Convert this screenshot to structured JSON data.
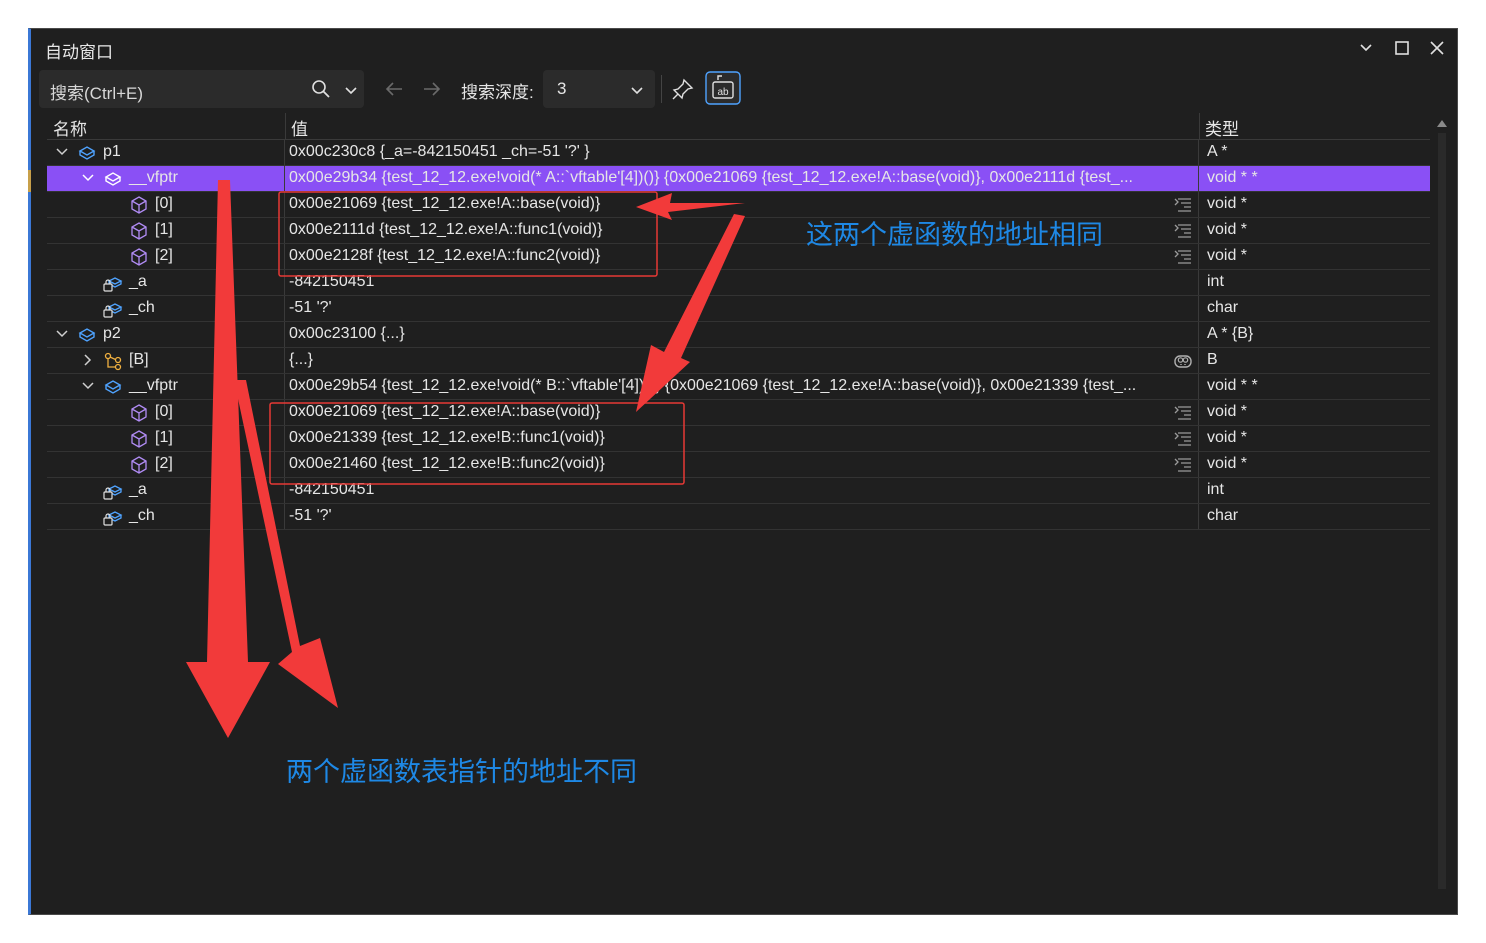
{
  "window": {
    "title": "自动窗口"
  },
  "toolbar": {
    "search_placeholder": "搜索(Ctrl+E)",
    "depth_label": "搜索深度:",
    "depth_value": "3"
  },
  "columns": {
    "name": "名称",
    "value": "值",
    "type": "类型"
  },
  "rows": [
    {
      "name": "p1",
      "value": "0x00c230c8 {_a=-842150451 _ch=-51 '?' }",
      "type": "A *"
    },
    {
      "name": "__vfptr",
      "value": "0x00e29b34 {test_12_12.exe!void(* A::`vftable'[4])()} {0x00e21069 {test_12_12.exe!A::base(void)}, 0x00e2111d {test_...",
      "type": "void * *"
    },
    {
      "name": "[0]",
      "value": "0x00e21069 {test_12_12.exe!A::base(void)}",
      "type": "void *"
    },
    {
      "name": "[1]",
      "value": "0x00e2111d {test_12_12.exe!A::func1(void)}",
      "type": "void *"
    },
    {
      "name": "[2]",
      "value": "0x00e2128f {test_12_12.exe!A::func2(void)}",
      "type": "void *"
    },
    {
      "name": "_a",
      "value": "-842150451",
      "type": "int"
    },
    {
      "name": "_ch",
      "value": "-51 '?'",
      "type": "char"
    },
    {
      "name": "p2",
      "value": "0x00c23100 {...}",
      "type": "A * {B}"
    },
    {
      "name": "[B]",
      "value": "{...}",
      "type": "B"
    },
    {
      "name": "__vfptr",
      "value": "0x00e29b54 {test_12_12.exe!void(* B::`vftable'[4])()} {0x00e21069 {test_12_12.exe!A::base(void)}, 0x00e21339 {test_...",
      "type": "void * *"
    },
    {
      "name": "[0]",
      "value": "0x00e21069 {test_12_12.exe!A::base(void)}",
      "type": "void *"
    },
    {
      "name": "[1]",
      "value": "0x00e21339 {test_12_12.exe!B::func1(void)}",
      "type": "void *"
    },
    {
      "name": "[2]",
      "value": "0x00e21460 {test_12_12.exe!B::func2(void)}",
      "type": "void *"
    },
    {
      "name": "_a",
      "value": "-842150451",
      "type": "int"
    },
    {
      "name": "_ch",
      "value": "-51 '?'",
      "type": "char"
    }
  ],
  "annotations": {
    "same_address": "这两个虚函数的地址相同",
    "different_vptr": "两个虚函数表指针的地址不同"
  },
  "colors": {
    "selection": "#8a50f5",
    "accent_icon": "#9b7ef0",
    "annotation_red": "#e53935",
    "annotation_blue": "#1e88e5"
  }
}
